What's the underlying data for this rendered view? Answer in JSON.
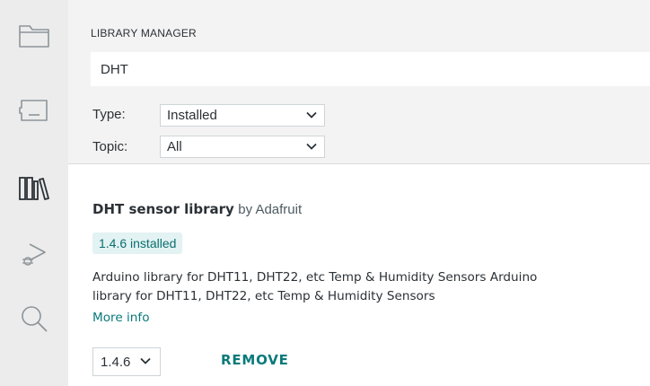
{
  "activity_bar": {
    "items": [
      {
        "icon": "folder-icon"
      },
      {
        "icon": "board-icon"
      },
      {
        "icon": "library-icon"
      },
      {
        "icon": "debug-icon"
      },
      {
        "icon": "search-icon"
      }
    ]
  },
  "panel": {
    "title": "LIBRARY MANAGER",
    "search_value": "DHT",
    "filters": {
      "type_label": "Type:",
      "type_value": "Installed",
      "topic_label": "Topic:",
      "topic_value": "All"
    }
  },
  "library": {
    "name": "DHT sensor library",
    "by": "by Adafruit",
    "installed_badge": "1.4.6 installed",
    "description_line1": "Arduino library for DHT11, DHT22, etc Temp & Humidity Sensors Arduino",
    "description_line2": "library for DHT11, DHT22, etc Temp & Humidity Sensors",
    "more_info": "More info",
    "version_selected": "1.4.6",
    "remove_label": "REMOVE"
  },
  "colors": {
    "accent": "#0a7a7a",
    "badge_bg": "#e3f2f2",
    "sidebar_bg": "#ececec",
    "header_bg": "#f3f3f3"
  }
}
